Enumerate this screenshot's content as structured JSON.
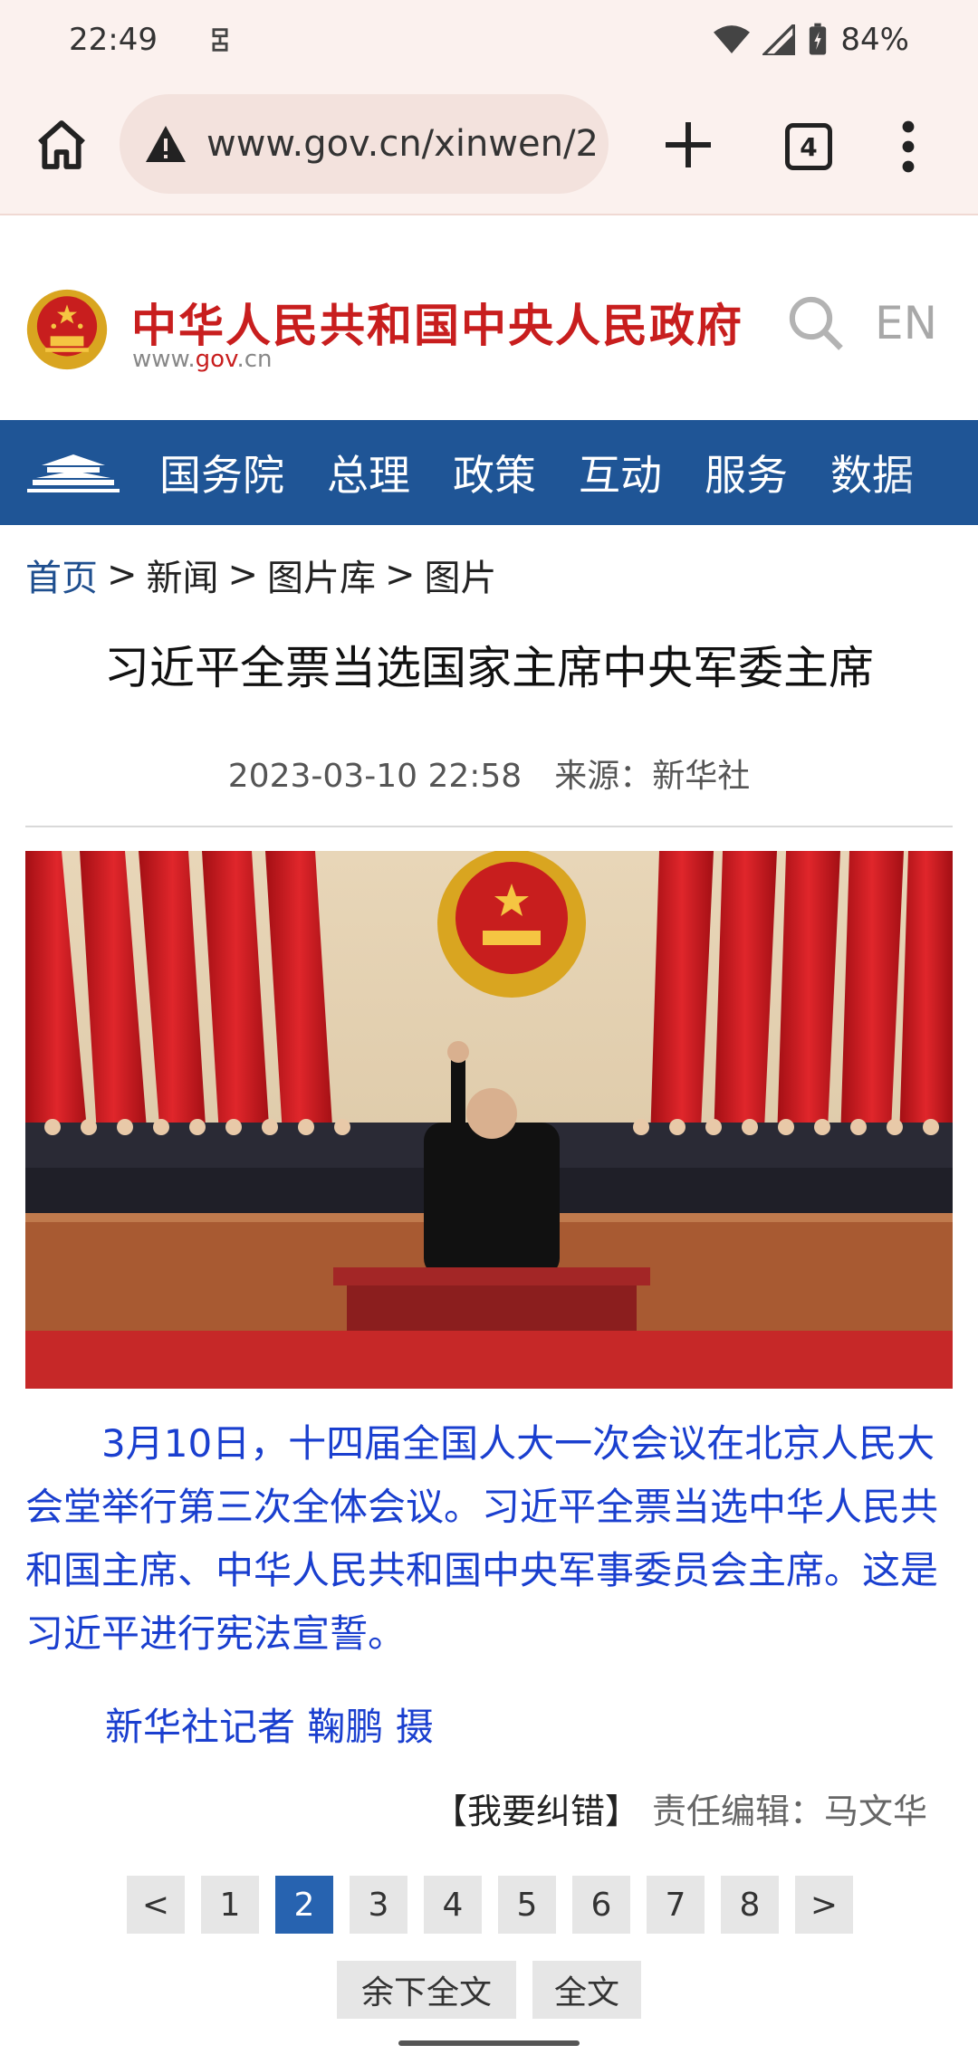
{
  "status_bar": {
    "time": "22:49",
    "battery": "84%",
    "icons": [
      "sync-icon",
      "wifi-icon",
      "signal-icon",
      "battery-icon"
    ]
  },
  "browser": {
    "url": "www.gov.cn/xinwen/2",
    "tab_count": "4",
    "icons": [
      "home-icon",
      "warning-icon",
      "plus-icon",
      "tabs-icon",
      "more-vert-icon"
    ]
  },
  "site": {
    "title": "中华人民共和国中央人民政府",
    "domain_prefix": "www.",
    "domain_highlight": "gov",
    "domain_suffix": ".cn",
    "english_link": "EN",
    "brand_color": "#c81e1e"
  },
  "nav": {
    "color": "#1f5596",
    "items": [
      "国务院",
      "总理",
      "政策",
      "互动",
      "服务",
      "数据"
    ]
  },
  "breadcrumb": {
    "home": "首页",
    "separator": ">",
    "items": [
      "新闻",
      "图片库",
      "图片"
    ]
  },
  "article": {
    "title": "习近平全票当选国家主席中央军委主席",
    "date": "2023-03-10 22:58",
    "source_label": "来源：",
    "source": "新华社",
    "body": "3月10日，十四届全国人大一次会议在北京人民大会堂举行第三次全体会议。习近平全票当选中华人民共和国主席、中华人民共和国中央军事委员会主席。这是习近平进行宪法宣誓。",
    "photo_credit": "新华社记者 鞠鹏 摄",
    "correction": "【我要纠错】",
    "editor_label": "责任编辑：",
    "editor": "马文华",
    "text_color": "#1a3fcf"
  },
  "pagination": {
    "prev": "<",
    "pages": [
      "1",
      "2",
      "3",
      "4",
      "5",
      "6",
      "7",
      "8"
    ],
    "current": "2",
    "next": ">",
    "read_rest": "余下全文",
    "read_full": "全文",
    "active_color": "#2763b0"
  }
}
